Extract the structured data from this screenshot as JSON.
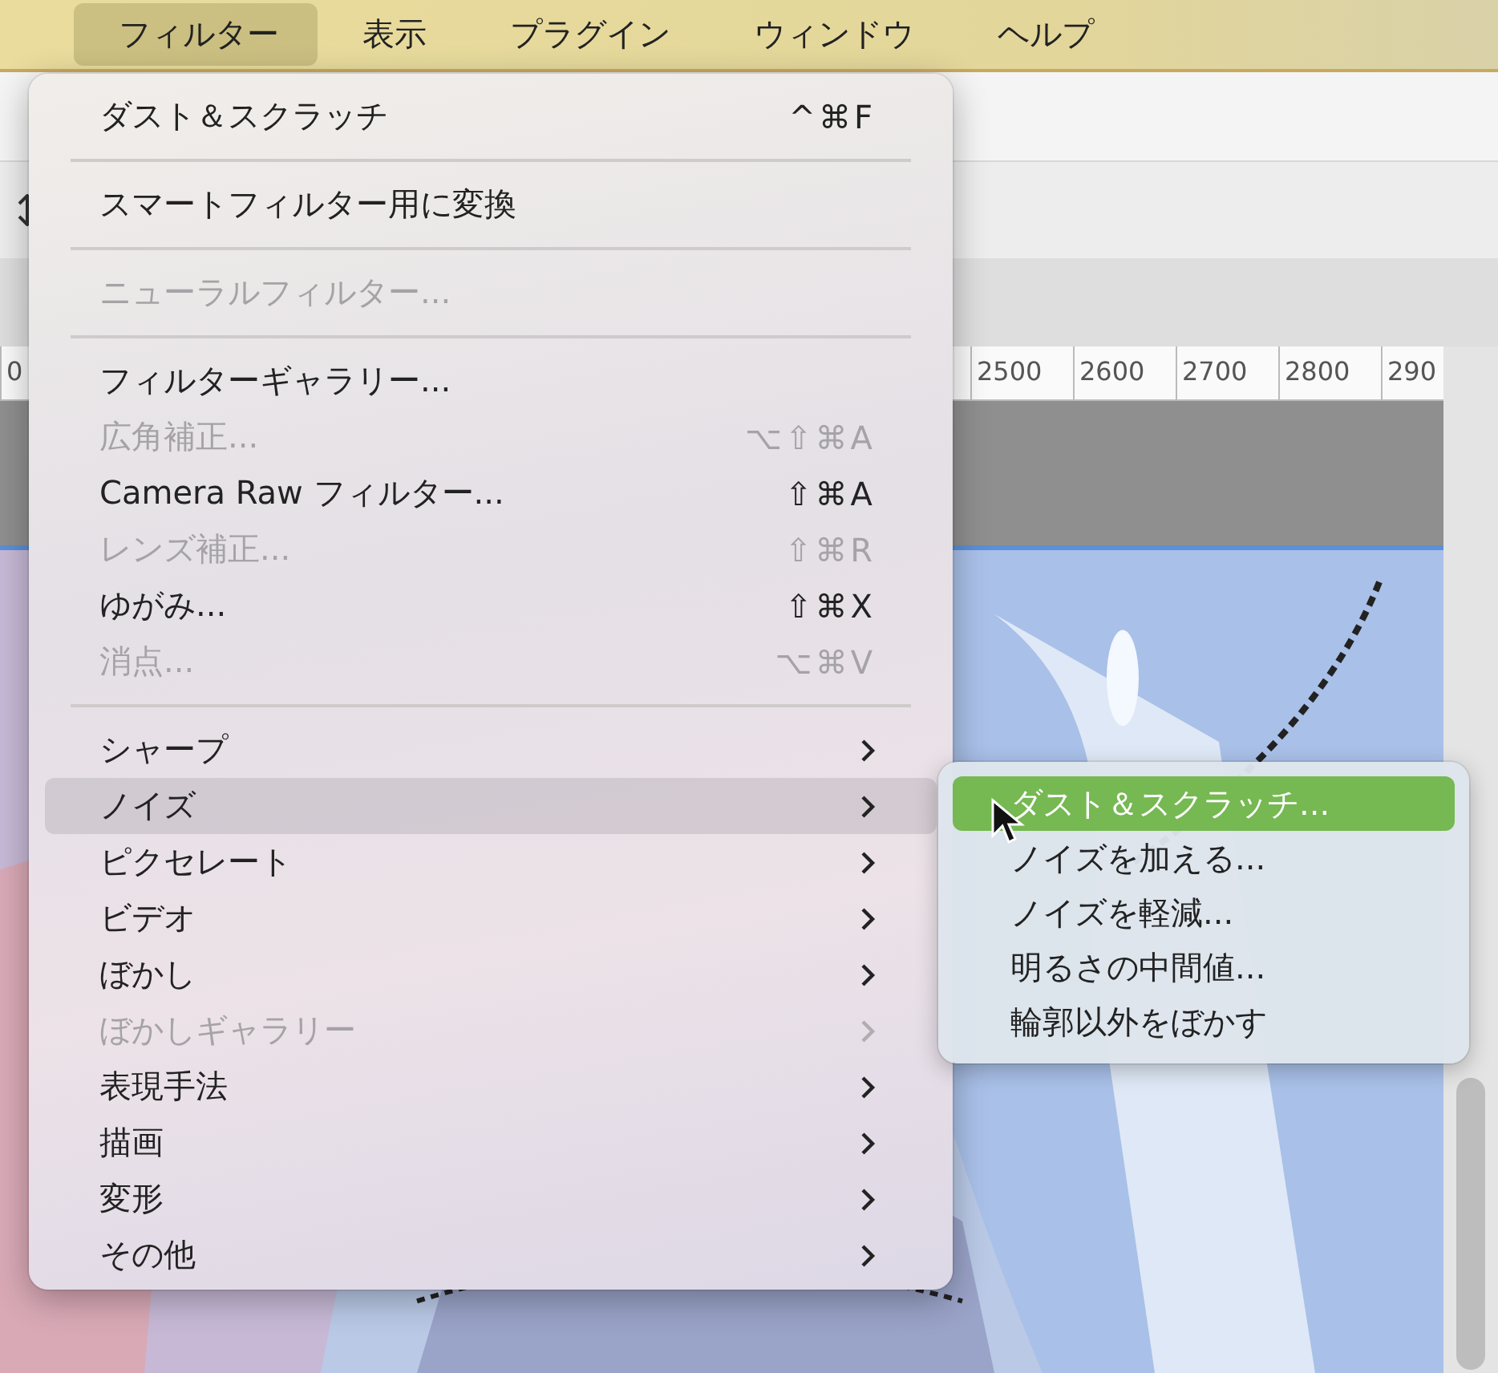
{
  "menu_bar": {
    "items": [
      {
        "label": "フィルター",
        "selected": true
      },
      {
        "label": "表示",
        "selected": false
      },
      {
        "label": "プラグイン",
        "selected": false
      },
      {
        "label": "ウィンドウ",
        "selected": false
      },
      {
        "label": "ヘルプ",
        "selected": false
      }
    ]
  },
  "ruler": {
    "labels": [
      "0",
      "2500",
      "2600",
      "2700",
      "2800",
      "290"
    ]
  },
  "filter_menu": {
    "items": [
      {
        "kind": "item",
        "label": "ダスト＆スクラッチ",
        "shortcut": "^⌘F",
        "disabled": false
      },
      {
        "kind": "separator"
      },
      {
        "kind": "item",
        "label": "スマートフィルター用に変換",
        "disabled": false
      },
      {
        "kind": "separator"
      },
      {
        "kind": "item",
        "label": "ニューラルフィルター...",
        "disabled": true
      },
      {
        "kind": "separator"
      },
      {
        "kind": "item",
        "label": "フィルターギャラリー...",
        "disabled": false
      },
      {
        "kind": "item",
        "label": "広角補正...",
        "shortcut": "⌥⇧⌘A",
        "disabled": true
      },
      {
        "kind": "item",
        "label": "Camera Raw フィルター...",
        "shortcut": "⇧⌘A",
        "disabled": false
      },
      {
        "kind": "item",
        "label": "レンズ補正...",
        "shortcut": "⇧⌘R",
        "disabled": true
      },
      {
        "kind": "item",
        "label": "ゆがみ...",
        "shortcut": "⇧⌘X",
        "disabled": false
      },
      {
        "kind": "item",
        "label": "消点...",
        "shortcut": "⌥⌘V",
        "disabled": true
      },
      {
        "kind": "separator"
      },
      {
        "kind": "submenu",
        "label": "シャープ",
        "disabled": false,
        "selected": false
      },
      {
        "kind": "submenu",
        "label": "ノイズ",
        "disabled": false,
        "selected": true
      },
      {
        "kind": "submenu",
        "label": "ピクセレート",
        "disabled": false,
        "selected": false
      },
      {
        "kind": "submenu",
        "label": "ビデオ",
        "disabled": false,
        "selected": false
      },
      {
        "kind": "submenu",
        "label": "ぼかし",
        "disabled": false,
        "selected": false
      },
      {
        "kind": "submenu",
        "label": "ぼかしギャラリー",
        "disabled": true,
        "selected": false
      },
      {
        "kind": "submenu",
        "label": "表現手法",
        "disabled": false,
        "selected": false
      },
      {
        "kind": "submenu",
        "label": "描画",
        "disabled": false,
        "selected": false
      },
      {
        "kind": "submenu",
        "label": "変形",
        "disabled": false,
        "selected": false
      },
      {
        "kind": "submenu",
        "label": "その他",
        "disabled": false,
        "selected": false
      }
    ]
  },
  "noise_submenu": {
    "items": [
      {
        "label": "ダスト＆スクラッチ...",
        "selected": true
      },
      {
        "label": "ノイズを加える...",
        "selected": false
      },
      {
        "label": "ノイズを軽減...",
        "selected": false
      },
      {
        "label": "明るさの中間値...",
        "selected": false
      },
      {
        "label": "輪郭以外をぼかす",
        "selected": false
      }
    ]
  }
}
